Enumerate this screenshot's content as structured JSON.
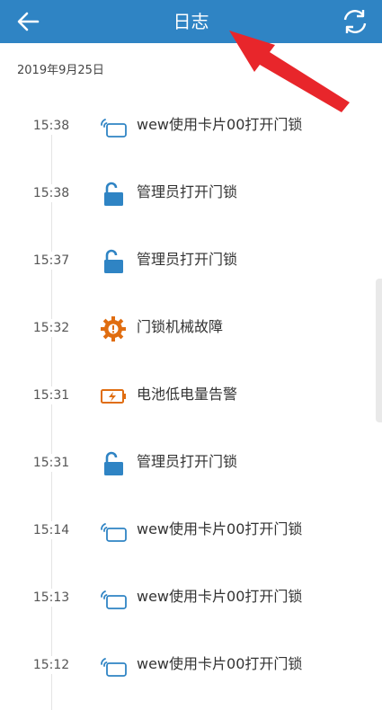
{
  "header": {
    "title": "日志",
    "back_icon": "arrow-left-icon",
    "refresh_icon": "refresh-icon",
    "background": "#2f84c4"
  },
  "date": "2019年9月25日",
  "entries": [
    {
      "time": "15:38",
      "message": "wew使用卡片00打开门锁",
      "icon": "card-icon"
    },
    {
      "time": "15:38",
      "message": "管理员打开门锁",
      "icon": "unlock-icon"
    },
    {
      "time": "15:37",
      "message": "管理员打开门锁",
      "icon": "unlock-icon"
    },
    {
      "time": "15:32",
      "message": "门锁机械故障",
      "icon": "gear-warning-icon"
    },
    {
      "time": "15:31",
      "message": "电池低电量告警",
      "icon": "battery-low-icon"
    },
    {
      "time": "15:31",
      "message": "管理员打开门锁",
      "icon": "unlock-icon"
    },
    {
      "time": "15:14",
      "message": "wew使用卡片00打开门锁",
      "icon": "card-icon"
    },
    {
      "time": "15:13",
      "message": "wew使用卡片00打开门锁",
      "icon": "card-icon"
    },
    {
      "time": "15:12",
      "message": "wew使用卡片00打开门锁",
      "icon": "card-icon"
    }
  ],
  "colors": {
    "accent_blue": "#2f84c4",
    "warning_orange": "#e06d10",
    "annotation_red": "#e8262b"
  }
}
